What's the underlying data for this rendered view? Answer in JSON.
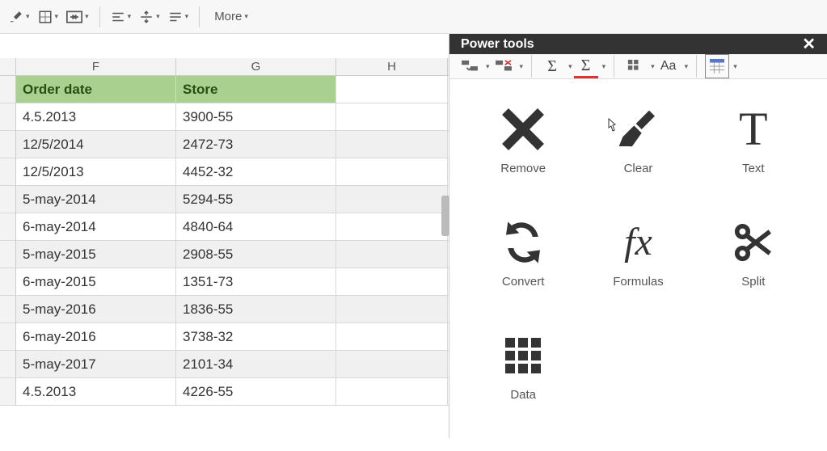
{
  "toolbar": {
    "more_label": "More"
  },
  "columns": {
    "F": "F",
    "G": "G",
    "H": "H"
  },
  "headers": {
    "F": "Order date",
    "G": "Store"
  },
  "rows": [
    {
      "F": "4.5.2013",
      "G": "3900-55"
    },
    {
      "F": "12/5/2014",
      "G": "2472-73"
    },
    {
      "F": "12/5/2013",
      "G": "4452-32"
    },
    {
      "F": "5-may-2014",
      "G": "5294-55"
    },
    {
      "F": "6-may-2014",
      "G": "4840-64"
    },
    {
      "F": "5-may-2015",
      "G": "2908-55"
    },
    {
      "F": "6-may-2015",
      "G": "1351-73"
    },
    {
      "F": "5-may-2016",
      "G": "1836-55"
    },
    {
      "F": "6-may-2016",
      "G": "3738-32"
    },
    {
      "F": "5-may-2017",
      "G": "2101-34"
    },
    {
      "F": "4.5.2013",
      "G": "4226-55"
    }
  ],
  "panel": {
    "title": "Power tools",
    "tools": {
      "remove": "Remove",
      "clear": "Clear",
      "text": "Text",
      "convert": "Convert",
      "formulas": "Formulas",
      "split": "Split",
      "data": "Data"
    }
  }
}
